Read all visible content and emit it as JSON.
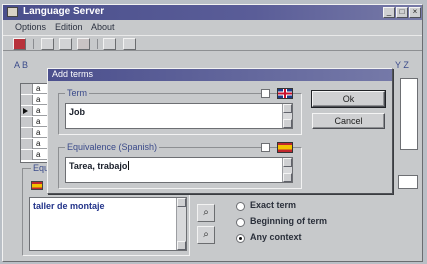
{
  "window": {
    "title": "Language Server",
    "controls": [
      "_",
      "□",
      "×"
    ]
  },
  "menu": {
    "items": [
      "Options",
      "Edition",
      "About"
    ]
  },
  "toolbar": {
    "icons": [
      "book-icon",
      "new-icon",
      "add-icon",
      "delete-icon",
      "link-icon",
      "settings-icon"
    ]
  },
  "background": {
    "column_letters_left": "A  B",
    "column_letters_right": "Y  Z",
    "grid_rows": [
      "a",
      "a",
      "a",
      "a",
      "a",
      "a",
      "a"
    ],
    "equivalence_legend": "Equ",
    "equivalence_list": "taller de montaje",
    "search_options": [
      "Exact term",
      "Beginning of term",
      "Any context"
    ],
    "selected_search_option": "Any context"
  },
  "dialog": {
    "title": "Add terms",
    "term_legend": "Term",
    "term_value": "Job",
    "equivalence_legend": "Equivalence (Spanish)",
    "equivalence_value": "Tarea, trabajo",
    "ok_label": "Ok",
    "cancel_label": "Cancel"
  },
  "colors": {
    "title_bar": "#4a4f8c",
    "legend_text": "#3a4a8a",
    "list_text": "#23348a",
    "window_face": "#c7c9cb"
  }
}
